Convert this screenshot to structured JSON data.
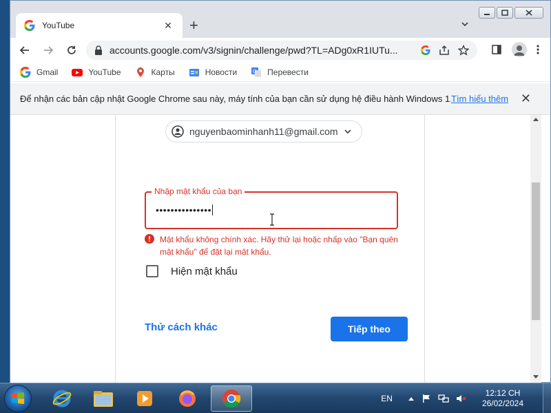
{
  "browser": {
    "tab": {
      "title": "YouTube"
    },
    "url": "accounts.google.com/v3/signin/challenge/pwd?TL=ADg0xR1IUTu...",
    "bookmarks": [
      {
        "label": "Gmail",
        "icon": "gmail-icon"
      },
      {
        "label": "YouTube",
        "icon": "youtube-icon"
      },
      {
        "label": "Карты",
        "icon": "maps-icon"
      },
      {
        "label": "Новости",
        "icon": "news-icon"
      },
      {
        "label": "Перевести",
        "icon": "translate-icon"
      }
    ],
    "infobar": {
      "text": "Để nhận các bản cập nhật Google Chrome sau này, máy tính của bạn cần sử dụng hệ điều hành Windows 1...",
      "link": "Tìm hiểu thêm"
    }
  },
  "signin": {
    "email": "nguyenbaominhanh11@gmail.com",
    "password_label": "Nhập mật khẩu của bạn",
    "password_value": "•••••••••••••••",
    "error": "Mật khẩu không chính xác. Hãy thử lại hoặc nhấp vào \"Bạn quên mật khẩu\" để đặt lại mật khẩu.",
    "show_password": "Hiện mật khẩu",
    "try_other": "Thử cách khác",
    "next": "Tiếp theo"
  },
  "taskbar": {
    "lang": "EN",
    "time": "12:12 CH",
    "date": "26/02/2024"
  },
  "colors": {
    "accent": "#1a73e8",
    "error": "#d93025"
  }
}
